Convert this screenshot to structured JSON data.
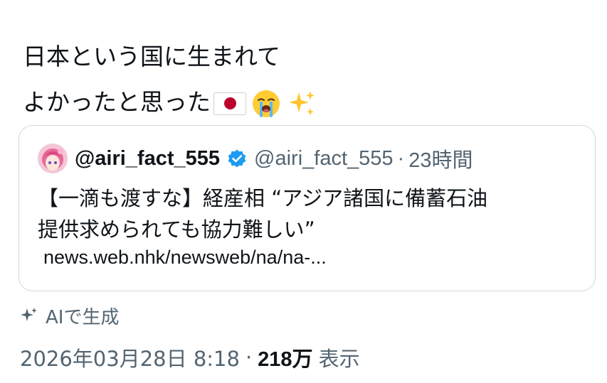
{
  "tweet": {
    "text_line1": "日本という国に生まれて",
    "text_line2": "よかったと思った",
    "emojis": [
      "flag-japan-icon",
      "loudly-crying-face-icon",
      "sparkles-icon"
    ]
  },
  "quote": {
    "display_name": "@airi_fact_555",
    "verified": true,
    "handle": "@airi_fact_555",
    "separator": "·",
    "time_ago": "23時間",
    "body_line1": "【一滴も渡すな】経産相 “アジア諸国に備蓄石油",
    "body_line2": "提供求められても協力難しい”",
    "link": "news.web.nhk/newsweb/na/na-..."
  },
  "ai_generated": {
    "label": "AIで生成",
    "icon": "sparkle-icon"
  },
  "meta": {
    "timestamp": "2026年03月28日 8:18",
    "separator": "·",
    "views_count": "218万",
    "views_label": "表示"
  },
  "colors": {
    "text_primary": "#0f1419",
    "text_secondary": "#536471",
    "border": "#cfd9de",
    "verified_blue": "#1d9bf0",
    "flag_red": "#bc002d"
  }
}
